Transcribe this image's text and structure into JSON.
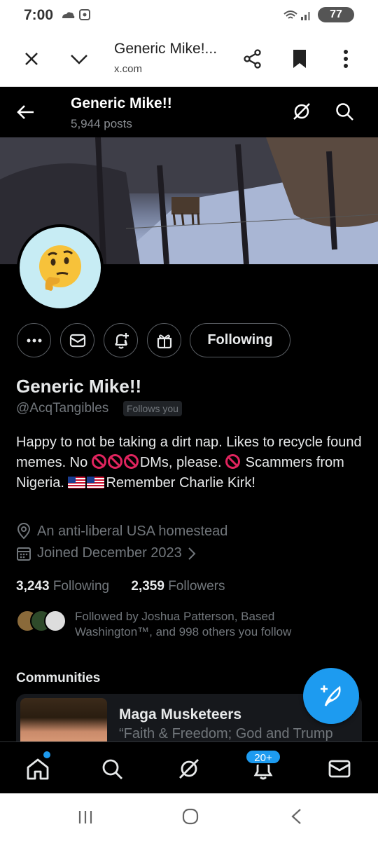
{
  "status_bar": {
    "time": "7:00",
    "battery": "77"
  },
  "browser": {
    "title": "Generic Mike!...",
    "url": "x.com"
  },
  "header": {
    "name": "Generic Mike!!",
    "posts": "5,944 posts"
  },
  "profile": {
    "name": "Generic Mike!!",
    "handle": "@AcqTangibles",
    "follows_you": "Follows you",
    "bio": {
      "part1": "Happy to not be taking a dirt nap. Likes to recycle found memes. No ",
      "part2": "DMs, please. ",
      "part3": "Scammers from Nigeria. ",
      "part4": "Remember Charlie Kirk!"
    },
    "location": "An anti-liberal USA homestead",
    "joined": "Joined December 2023",
    "following_count": "3,243",
    "following_label": "Following",
    "followers_count": "2,359",
    "followers_label": "Followers",
    "followed_by": "Followed by Joshua Patterson, Based Washington™, and 998 others you follow"
  },
  "actions": {
    "following_button": "Following"
  },
  "communities": {
    "label": "Communities",
    "items": [
      {
        "name": "Maga Musketeers",
        "description": "“Faith & Freedom; God and Trump"
      }
    ]
  },
  "bottom_nav": {
    "notifications_badge": "20+"
  },
  "colors": {
    "accent": "#1d9bf0",
    "background": "#000000",
    "text": "#e7e9ea",
    "muted": "#71767b"
  }
}
